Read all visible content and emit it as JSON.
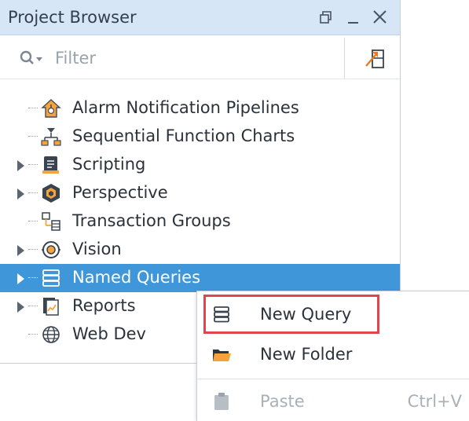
{
  "panel": {
    "title": "Project Browser",
    "controls": [
      "restore-icon",
      "minimize-icon",
      "close-icon"
    ]
  },
  "filter": {
    "placeholder": "Filter",
    "icon": "search-dropdown-icon"
  },
  "locate_button": {
    "icon": "locate-in-tree-icon"
  },
  "tree": {
    "items": [
      {
        "label": "Alarm Notification Pipelines",
        "icon": "alarm-pipeline-icon",
        "expandable": false,
        "selected": false
      },
      {
        "label": "Sequential Function Charts",
        "icon": "sfc-icon",
        "expandable": false,
        "selected": false
      },
      {
        "label": "Scripting",
        "icon": "scripting-icon",
        "expandable": true,
        "selected": false
      },
      {
        "label": "Perspective",
        "icon": "perspective-icon",
        "expandable": true,
        "selected": false
      },
      {
        "label": "Transaction Groups",
        "icon": "transaction-groups-icon",
        "expandable": false,
        "selected": false
      },
      {
        "label": "Vision",
        "icon": "vision-icon",
        "expandable": true,
        "selected": false
      },
      {
        "label": "Named Queries",
        "icon": "named-queries-icon",
        "expandable": true,
        "selected": true
      },
      {
        "label": "Reports",
        "icon": "reports-icon",
        "expandable": true,
        "selected": false
      },
      {
        "label": "Web Dev",
        "icon": "web-dev-icon",
        "expandable": false,
        "selected": false
      }
    ]
  },
  "context_menu": {
    "items": [
      {
        "label": "New Query",
        "icon": "database-query-icon",
        "enabled": true,
        "highlighted": true,
        "shortcut": ""
      },
      {
        "label": "New Folder",
        "icon": "folder-icon",
        "enabled": true,
        "highlighted": false,
        "shortcut": ""
      },
      {
        "label": "Paste",
        "icon": "clipboard-icon",
        "enabled": false,
        "highlighted": false,
        "shortcut": "Ctrl+V"
      }
    ]
  },
  "colors": {
    "titlebar_bg": "#d7e6f7",
    "selection": "#3f97da",
    "highlight_outline": "#e0454b",
    "text": "#2b323a",
    "disabled_text": "#a9b0b8"
  }
}
